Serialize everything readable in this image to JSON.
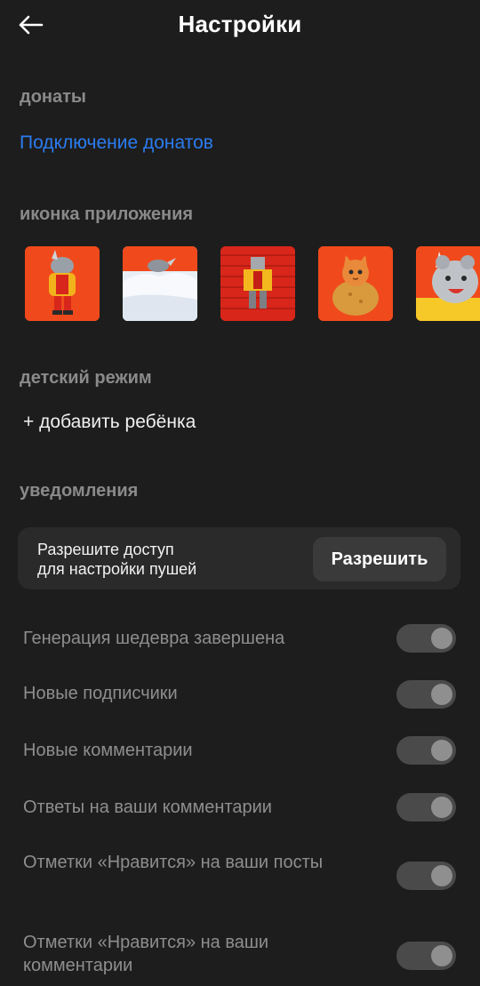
{
  "header": {
    "title": "Настройки"
  },
  "donations": {
    "section_title": "донаты",
    "link_label": "Подключение донатов"
  },
  "app_icon": {
    "section_title": "иконка приложения",
    "icons": [
      {
        "name": "rhino-yellow-jacket-icon"
      },
      {
        "name": "rhino-in-snow-icon"
      },
      {
        "name": "knitted-rhino-icon"
      },
      {
        "name": "cat-in-bread-icon"
      },
      {
        "name": "cartoon-rhino-yellow-icon"
      }
    ]
  },
  "kids_mode": {
    "section_title": "детский режим",
    "add_child_label": "+ добавить ребёнка"
  },
  "notifications": {
    "section_title": "уведомления",
    "permission_text_line1": "Разрешите доступ",
    "permission_text_line2": "для настройки пушей",
    "allow_label": "Разрешить",
    "settings": [
      {
        "label": "Генерация шедевра завершена",
        "enabled": true
      },
      {
        "label": "Новые подписчики",
        "enabled": true
      },
      {
        "label": "Новые комментарии",
        "enabled": true
      },
      {
        "label": "Ответы на ваши комментарии",
        "enabled": true
      },
      {
        "label": "Отметки «Нравится» на ваши посты",
        "enabled": true
      },
      {
        "label": "Отметки «Нравится» на ваши комментарии",
        "enabled": true
      }
    ]
  },
  "colors": {
    "background": "#1d1d1d",
    "accent_link": "#2b7cf0",
    "card": "#2a2a2a"
  }
}
